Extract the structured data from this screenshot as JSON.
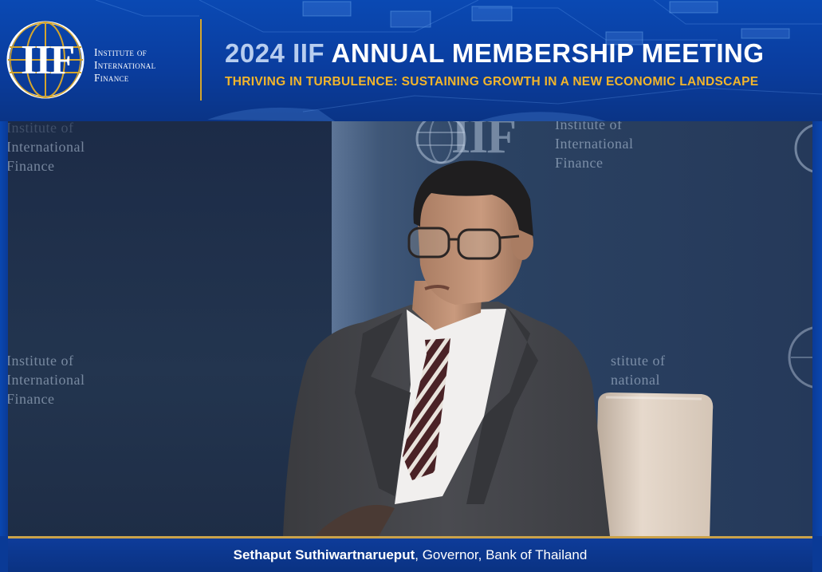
{
  "banner": {
    "logo": {
      "mark": "IIF",
      "lines": [
        "Institute of",
        "International",
        "Finance"
      ]
    },
    "title_year": "2024 IIF",
    "title_rest": "ANNUAL MEMBERSHIP MEETING",
    "subtitle": "THRIVING IN TURBULENCE: SUSTAINING GROWTH IN A NEW ECONOMIC LANDSCAPE"
  },
  "backdrop": {
    "top_left_lines": [
      "Institute of",
      "International",
      "Finance"
    ],
    "mid_left_lines": [
      "Institute of",
      "International",
      "Finance"
    ],
    "top_center_mark": "IIF",
    "top_center_lines": [
      "Institute of",
      "International",
      "Finance"
    ],
    "mid_right_lines": [
      "stitute of",
      "national"
    ]
  },
  "caption": {
    "name": "Sethaput Suthiwartnarueput",
    "role": ", Governor, Bank of Thailand"
  },
  "colors": {
    "banner_blue": "#0a3d9f",
    "accent_gold": "#f2b52b",
    "caption_blue": "#0a3282"
  }
}
